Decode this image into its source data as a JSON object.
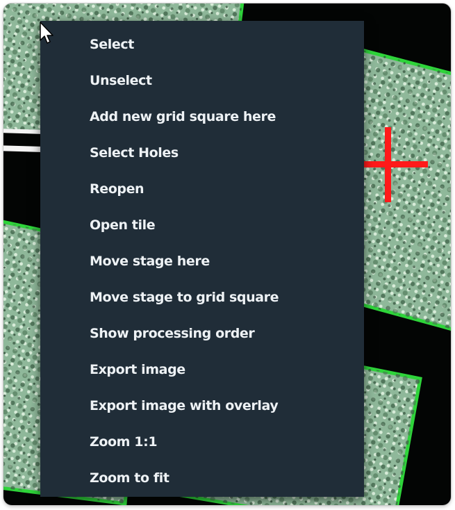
{
  "viewer": {
    "name": "atlas-image-view",
    "colors": {
      "background": "#030504",
      "tile": "#8fb89a",
      "tile_border": "#2ed43a",
      "selected_border": "#f4f4f4",
      "target_marker": "#ff1a1a"
    }
  },
  "context_menu": {
    "items": [
      {
        "id": "select",
        "label": "Select"
      },
      {
        "id": "unselect",
        "label": "Unselect"
      },
      {
        "id": "add-new-grid-square-here",
        "label": "Add new grid square here"
      },
      {
        "id": "select-holes",
        "label": "Select Holes"
      },
      {
        "id": "reopen",
        "label": "Reopen"
      },
      {
        "id": "open-tile",
        "label": "Open tile"
      },
      {
        "id": "move-stage-here",
        "label": "Move stage here"
      },
      {
        "id": "move-stage-to-grid-square",
        "label": "Move stage to grid square"
      },
      {
        "id": "show-processing-order",
        "label": "Show processing order"
      },
      {
        "id": "export-image",
        "label": "Export image"
      },
      {
        "id": "export-image-with-overlay",
        "label": "Export image with overlay"
      },
      {
        "id": "zoom-1-1",
        "label": "Zoom 1:1"
      },
      {
        "id": "zoom-to-fit",
        "label": "Zoom to fit"
      }
    ],
    "colors": {
      "background": "#202d38",
      "text": "#eef2f5"
    }
  },
  "cursor": {
    "icon": "arrow-pointer-icon"
  }
}
